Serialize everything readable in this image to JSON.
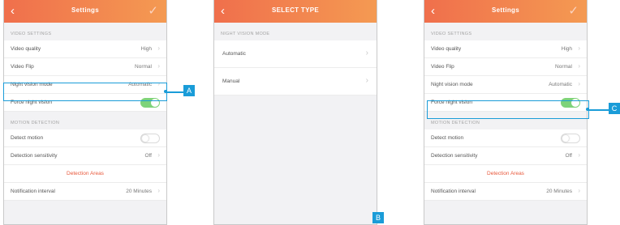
{
  "screen1": {
    "header": {
      "back": "‹",
      "title": "Settings",
      "check": "✓"
    },
    "video_section": "VIDEO SETTINGS",
    "video_rows": [
      {
        "label": "Video quality",
        "value": "High"
      },
      {
        "label": "Video Flip",
        "value": "Normal"
      },
      {
        "label": "Night vision mode",
        "value": "Automatic"
      }
    ],
    "force_night_vision": {
      "label": "Force night vision",
      "state": "on"
    },
    "motion_section": "MOTION DETECTION",
    "detect_motion": {
      "label": "Detect motion",
      "state": "off"
    },
    "detection_sensitivity": {
      "label": "Detection sensitivity",
      "value": "Off"
    },
    "detection_areas": "Detection Areas",
    "notification_interval": {
      "label": "Notification interval",
      "value": "20 Minutes"
    }
  },
  "screen2": {
    "header": {
      "back": "‹",
      "title": "SELECT TYPE"
    },
    "section": "NIGHT VISION MODE",
    "options": [
      "Automatic",
      "Manual"
    ]
  },
  "screen3": {
    "header": {
      "back": "‹",
      "title": "Settings",
      "check": "✓"
    },
    "video_section": "VIDEO SETTINGS",
    "video_rows": [
      {
        "label": "Video quality",
        "value": "High"
      },
      {
        "label": "Video Flip",
        "value": "Normal"
      },
      {
        "label": "Night vision mode",
        "value": "Automatic"
      }
    ],
    "force_night_vision": {
      "label": "Force night vision",
      "state": "on"
    },
    "motion_section": "MOTION DETECTION",
    "detect_motion": {
      "label": "Detect motion",
      "state": "off"
    },
    "detection_sensitivity": {
      "label": "Detection sensitivity",
      "value": "Off"
    },
    "detection_areas": "Detection Areas",
    "notification_interval": {
      "label": "Notification interval",
      "value": "20 Minutes"
    }
  },
  "callouts": {
    "a": "A",
    "b": "B",
    "c": "C"
  },
  "colors": {
    "header_start": "#f06f4c",
    "header_end": "#f49a52",
    "accent": "#1a9cd8",
    "toggle_on": "#7ed37a",
    "link": "#e8583b"
  },
  "chevron": "›"
}
